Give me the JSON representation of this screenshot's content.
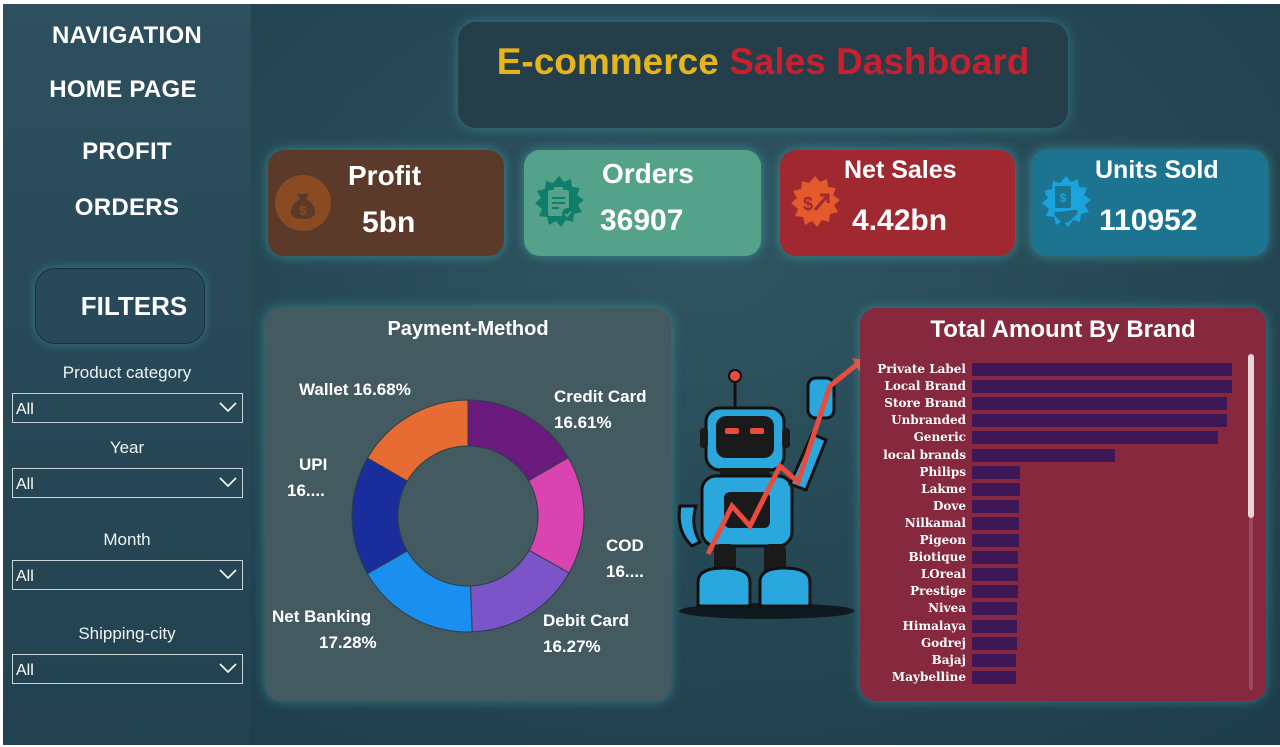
{
  "nav": {
    "heading": "NAVIGATION",
    "home": "HOME PAGE",
    "profit": "PROFIT",
    "orders": "ORDERS"
  },
  "filters": {
    "button": "FILTERS",
    "items": [
      {
        "label": "Product category",
        "value": "All"
      },
      {
        "label": "Year",
        "value": "All"
      },
      {
        "label": "Month",
        "value": "All"
      },
      {
        "label": "Shipping-city",
        "value": "All"
      }
    ]
  },
  "title": {
    "part1": "E-commerce",
    "part2": "Sales Dashboard"
  },
  "kpis": {
    "profit": {
      "label": "Profit",
      "value": "5bn",
      "icon": "money-bag-icon"
    },
    "orders": {
      "label": "Orders",
      "value": "36907",
      "icon": "clipboard-check-icon"
    },
    "net_sales": {
      "label": "Net Sales",
      "value": "4.42bn",
      "icon": "dollar-arrow-icon"
    },
    "units_sold": {
      "label": "Units Sold",
      "value": "110952",
      "icon": "phone-receipt-icon"
    }
  },
  "payment": {
    "title": "Payment-Method",
    "labels": {
      "wallet": "Wallet 16.68%",
      "credit_card": "Credit Card",
      "credit_card_pct": "16.61%",
      "upi": "UPI",
      "upi_pct": "16....",
      "cod": "COD",
      "cod_pct": "16....",
      "net_banking": "Net Banking",
      "net_banking_pct": "17.28%",
      "debit_card": "Debit Card",
      "debit_card_pct": "16.27%"
    }
  },
  "brand": {
    "title": "Total Amount By Brand"
  },
  "colors": {
    "credit_card": "#6a1b7d",
    "cod": "#d944b0",
    "debit_card": "#7b55c8",
    "net_banking": "#1b8fef",
    "upi": "#1a2d9c",
    "wallet": "#e66c33",
    "brand_bar": "#3e1756"
  },
  "chart_data": [
    {
      "type": "pie",
      "title": "Payment-Method",
      "categories": [
        "Credit Card",
        "COD",
        "Debit Card",
        "Net Banking",
        "UPI",
        "Wallet"
      ],
      "values": [
        16.61,
        16.55,
        16.27,
        17.28,
        16.61,
        16.68
      ]
    },
    {
      "type": "bar",
      "orientation": "horizontal",
      "title": "Total Amount By Brand",
      "categories": [
        "Private Label",
        "Local Brand",
        "Store Brand",
        "Unbranded",
        "Generic",
        "local brands",
        "Philips",
        "Lakme",
        "Dove",
        "Nilkamal",
        "Pigeon",
        "Biotique",
        "LOreal",
        "Prestige",
        "Nivea",
        "Himalaya",
        "Godrej",
        "Bajaj",
        "Maybelline"
      ],
      "values": [
        236,
        236,
        232,
        232,
        224,
        130,
        44,
        44,
        43,
        43,
        43,
        42,
        42,
        42,
        41,
        41,
        41,
        40,
        40
      ],
      "xlim": [
        0,
        240
      ]
    }
  ]
}
